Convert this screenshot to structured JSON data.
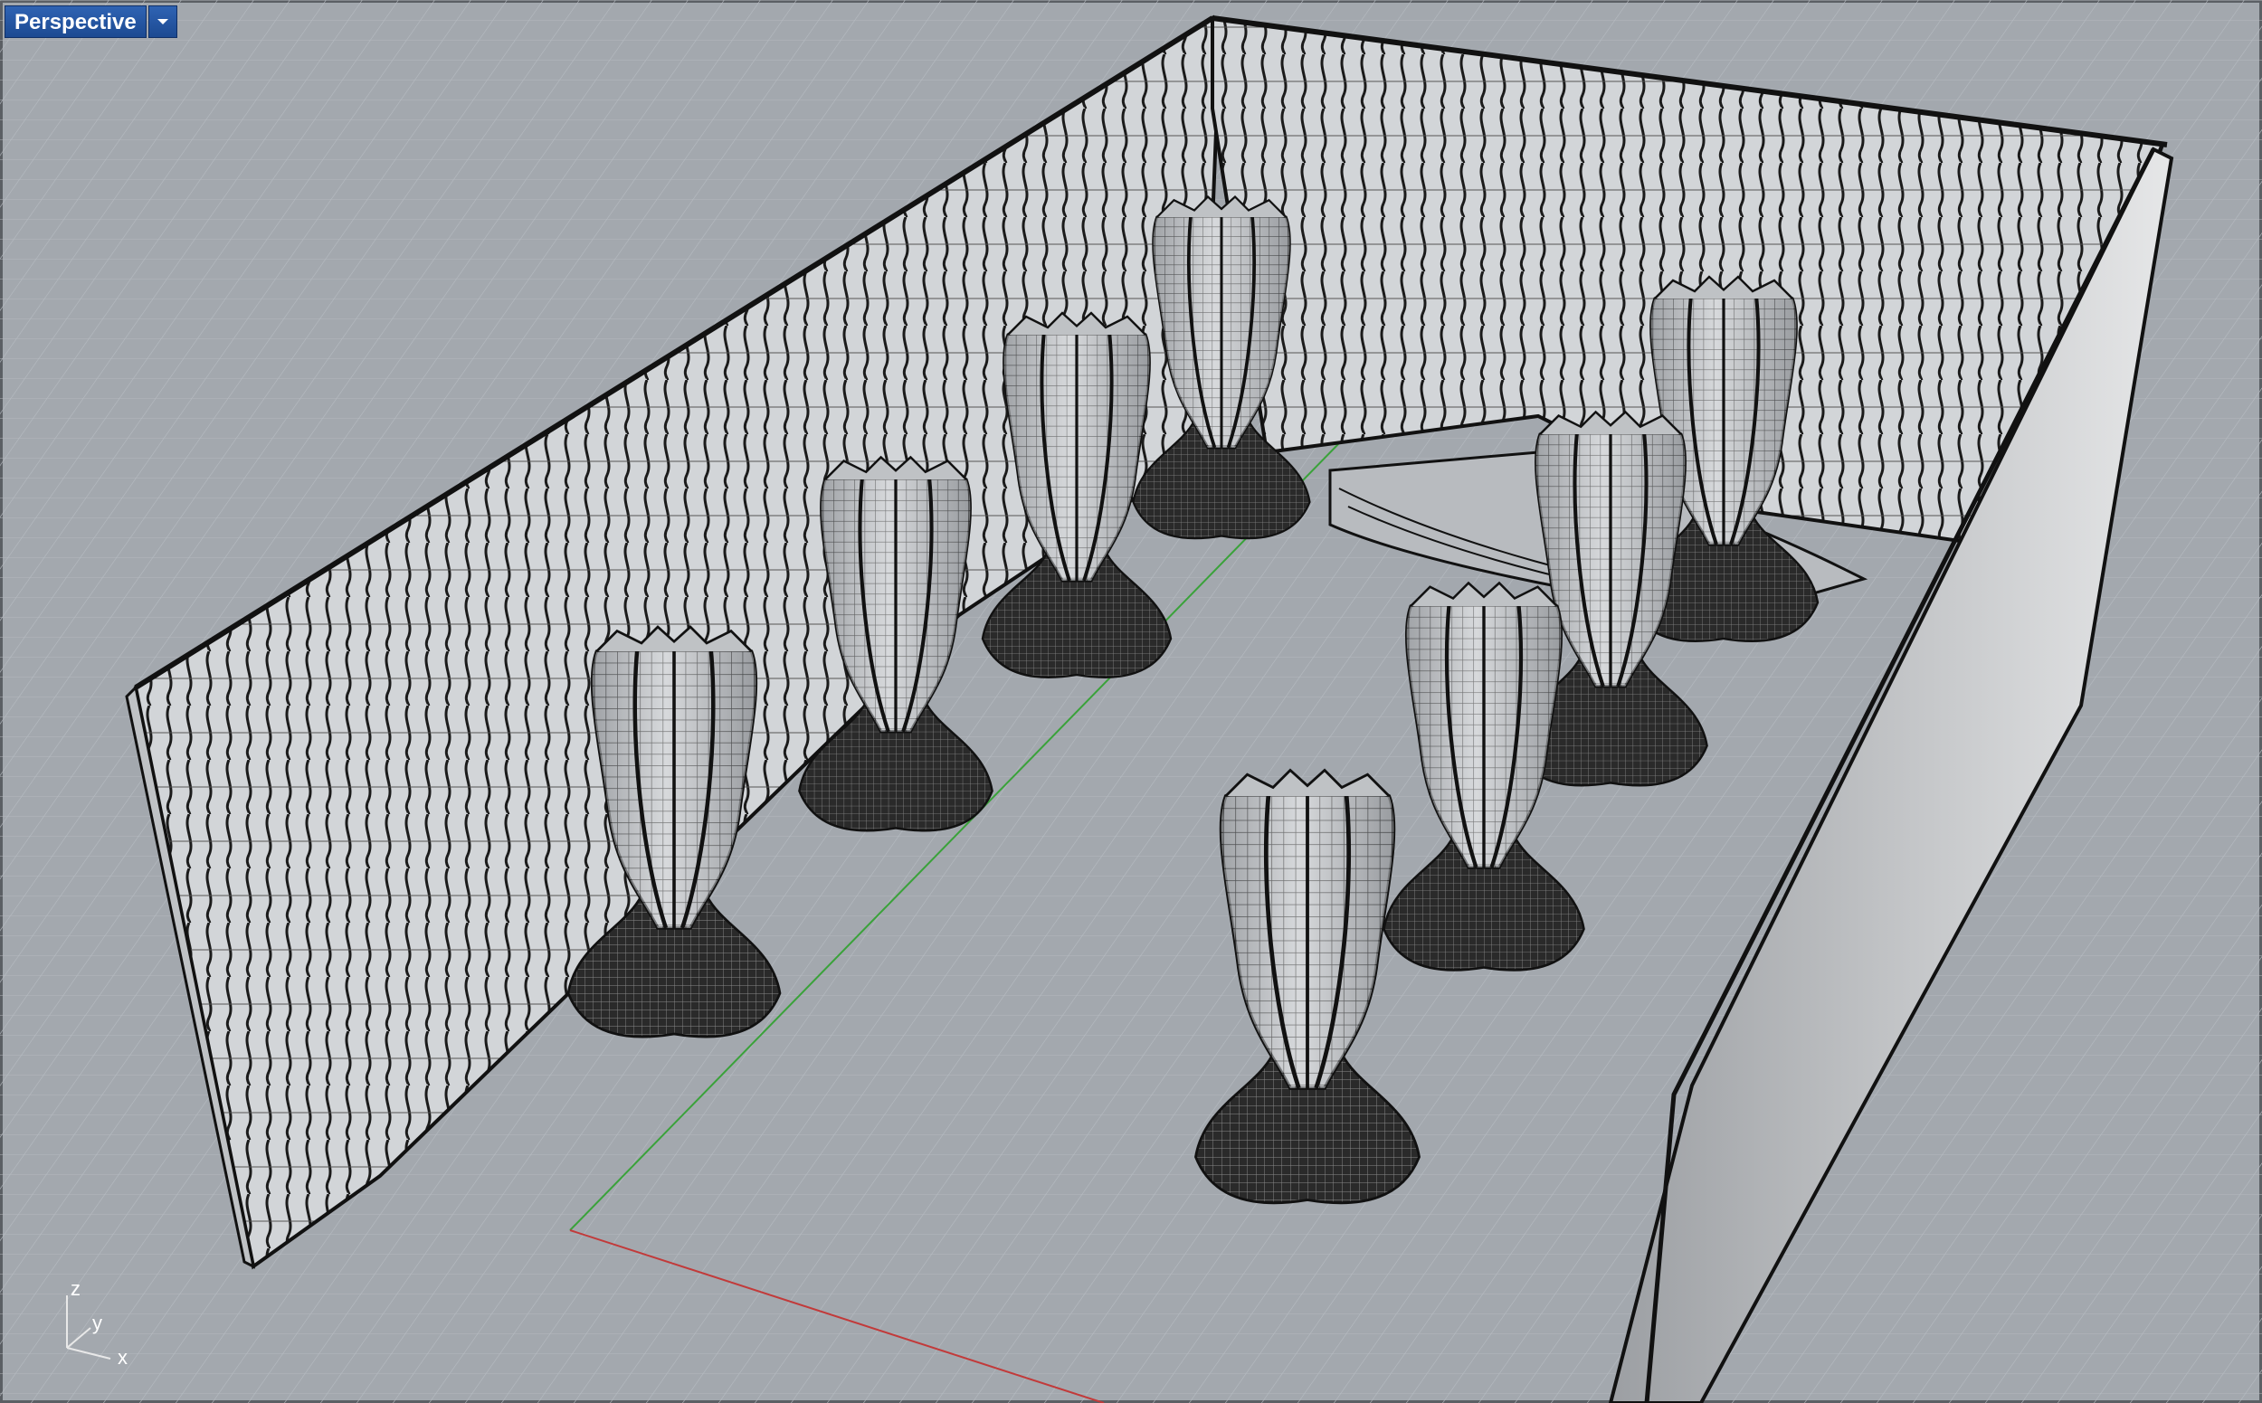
{
  "viewport": {
    "title": "Perspective",
    "menu_icon": "chevron-down-icon",
    "colors": {
      "background": "#a3a8ae",
      "grid": "#b4b9bf",
      "title_bar": "#2458a8",
      "model_fill": "#cfd2d5",
      "model_edge": "#1a1a1a"
    }
  },
  "axis_widget": {
    "z": "z",
    "y": "y",
    "x": "x"
  }
}
